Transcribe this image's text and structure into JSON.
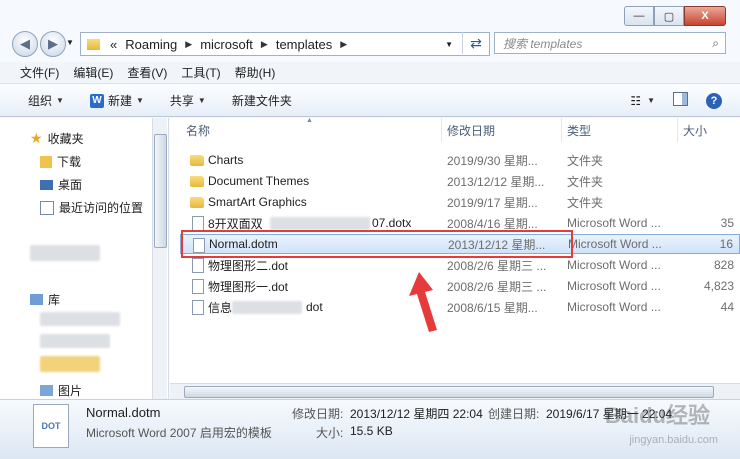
{
  "window": {
    "min": "—",
    "max": "▢",
    "close": "X"
  },
  "address": {
    "lead": "«",
    "segments": [
      "Roaming",
      "microsoft",
      "templates"
    ]
  },
  "search": {
    "placeholder": "搜索 templates"
  },
  "menu": [
    "文件(F)",
    "编辑(E)",
    "查看(V)",
    "工具(T)",
    "帮助(H)"
  ],
  "toolbar": {
    "organize": "组织",
    "new": "新建",
    "share": "共享",
    "new_folder": "新建文件夹"
  },
  "nav": {
    "favorites": "收藏夹",
    "download": "下载",
    "desktop": "桌面",
    "recent": "最近访问的位置",
    "library": "库",
    "pictures": "图片"
  },
  "columns": {
    "name": "名称",
    "date": "修改日期",
    "type": "类型",
    "size": "大小"
  },
  "files": [
    {
      "name": "Charts",
      "date": "2019/9/30 星期...",
      "type": "文件夹",
      "size": "",
      "icon": "folder"
    },
    {
      "name": "Document Themes",
      "date": "2013/12/12 星期...",
      "type": "文件夹",
      "size": "",
      "icon": "folder"
    },
    {
      "name": "SmartArt Graphics",
      "date": "2019/9/17 星期...",
      "type": "文件夹",
      "size": "",
      "icon": "folder"
    },
    {
      "name": "8开双面双",
      "name_tail": "07.dotx",
      "date": "2008/4/16 星期...",
      "type": "Microsoft Word ...",
      "size": "35",
      "icon": "doc"
    },
    {
      "name": "Normal.dotm",
      "date": "2013/12/12 星期...",
      "type": "Microsoft Word ...",
      "size": "16",
      "icon": "doc",
      "selected": true
    },
    {
      "name": "物理图形二.dot",
      "date": "2008/2/6 星期三 ...",
      "type": "Microsoft Word ...",
      "size": "828",
      "icon": "doc"
    },
    {
      "name": "物理图形一.dot",
      "date": "2008/2/6 星期三 ...",
      "type": "Microsoft Word ...",
      "size": "4,823",
      "icon": "doc"
    },
    {
      "name": "信息",
      "name_tail": "dot",
      "date": "2008/6/15 星期...",
      "type": "Microsoft Word ...",
      "size": "44",
      "icon": "doc"
    }
  ],
  "details": {
    "icon_label": "DOT",
    "name": "Normal.dotm",
    "type": "Microsoft Word 2007 启用宏的模板",
    "modified_label": "修改日期:",
    "modified": "2013/12/12 星期四 22:04",
    "created_label": "创建日期:",
    "created": "2019/6/17 星期一 22:04",
    "size_label": "大小:",
    "size": "15.5 KB"
  },
  "watermark": {
    "main": "Baidu经验",
    "url": "jingyan.baidu.com"
  }
}
